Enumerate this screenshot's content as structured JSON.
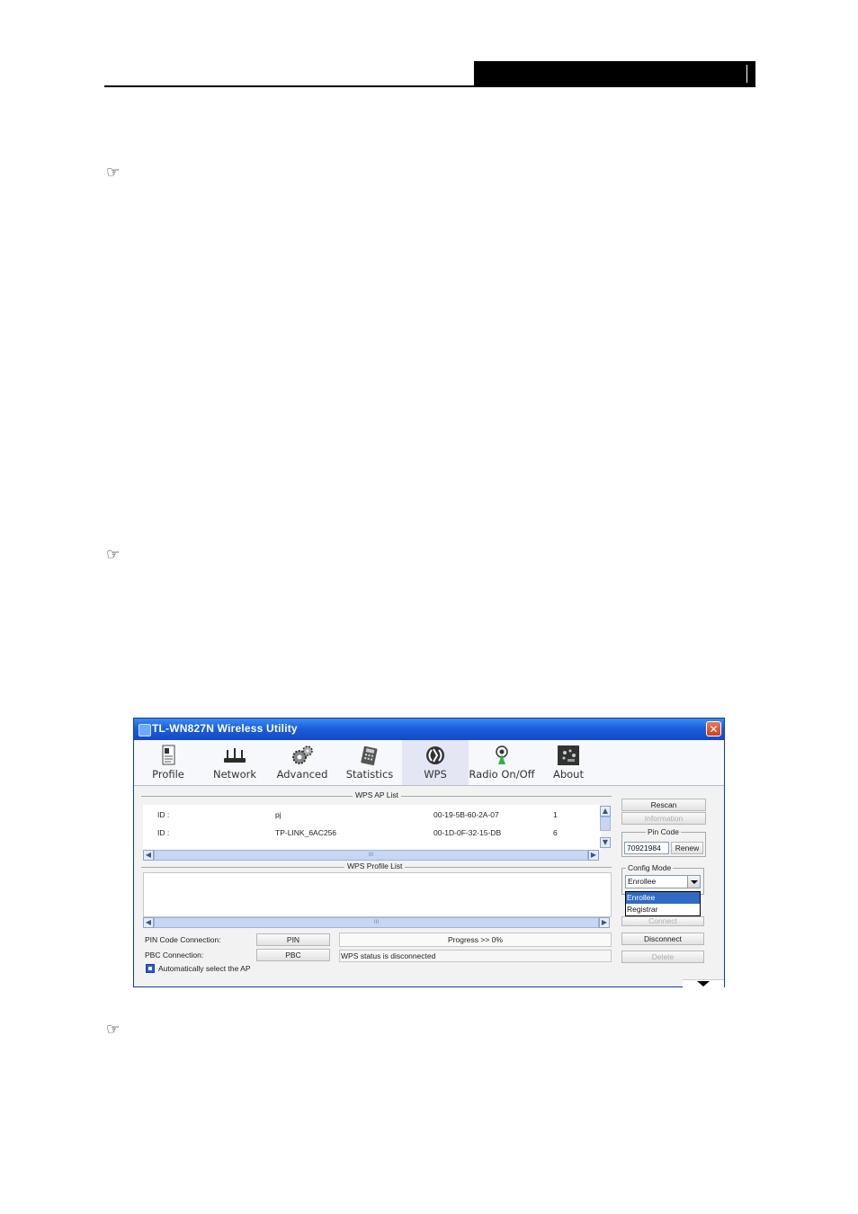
{
  "window": {
    "title": "TL-WN827N Wireless Utility",
    "close_glyph": "✕"
  },
  "toolbar": {
    "items": [
      {
        "label": "Profile",
        "icon": "profile-icon"
      },
      {
        "label": "Network",
        "icon": "network-icon"
      },
      {
        "label": "Advanced",
        "icon": "advanced-gear-icon"
      },
      {
        "label": "Statistics",
        "icon": "statistics-icon"
      },
      {
        "label": "WPS",
        "icon": "wps-icon"
      },
      {
        "label": "Radio On/Off",
        "icon": "radio-antenna-icon"
      },
      {
        "label": "About",
        "icon": "about-icon"
      }
    ],
    "active": "WPS"
  },
  "wps_ap_list": {
    "label": "WPS AP List",
    "rows": [
      {
        "id_label": "ID :",
        "ssid": "pj",
        "mac": "00-19-5B-60-2A-07",
        "channel": "1"
      },
      {
        "id_label": "ID :",
        "ssid": "TP-LINK_6AC256",
        "mac": "00-1D-0F-32-15-DB",
        "channel": "6"
      }
    ]
  },
  "wps_profile_list": {
    "label": "WPS Profile List"
  },
  "scroll": {
    "mid_grip": "III"
  },
  "side": {
    "rescan": "Rescan",
    "information": "Information",
    "pin_code_label": "Pin Code",
    "pin_code_value": "70921984",
    "renew": "Renew",
    "config_mode_label": "Config Mode",
    "config_mode_value": "Enrollee",
    "config_mode_options": [
      "Enrollee",
      "Registrar"
    ],
    "connect": "Connect",
    "disconnect": "Disconnect",
    "delete": "Delete"
  },
  "bottom": {
    "pin_connection_label": "PIN Code Connection:",
    "pin_button": "PIN",
    "pbc_connection_label": "PBC Connection:",
    "pbc_button": "PBC",
    "auto_select_label": "Automatically select the AP",
    "progress_text": "Progress >> 0%",
    "status_text": "WPS status is disconnected"
  },
  "doc": {
    "note_glyph": "☞"
  }
}
